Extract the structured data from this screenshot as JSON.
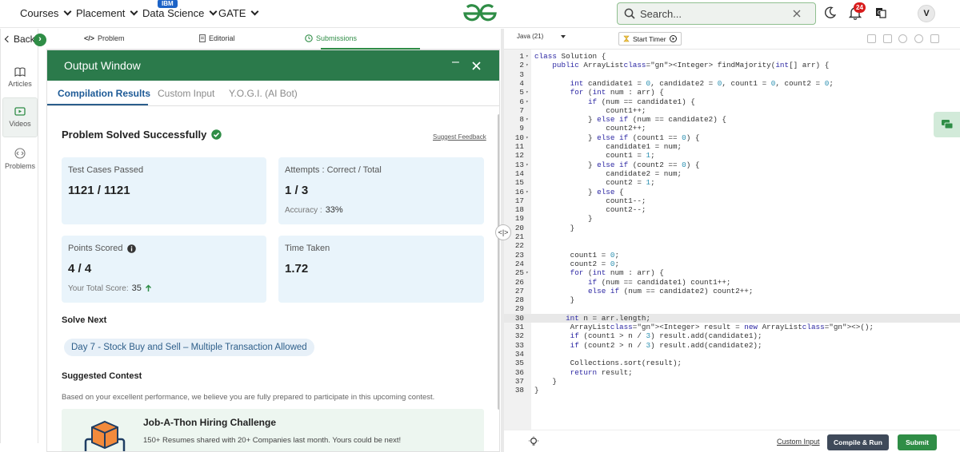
{
  "nav": {
    "items": [
      "Courses",
      "Placement",
      "Data Science",
      "GATE"
    ],
    "ibm_badge": "IBM",
    "search_placeholder": "Search...",
    "notification_count": "24",
    "avatar_initial": "V"
  },
  "rail": {
    "back_label": "Back",
    "items": [
      "Articles",
      "Videos",
      "Problems"
    ]
  },
  "problem_tabs": [
    "Problem",
    "Editorial",
    "Submissions"
  ],
  "output": {
    "title": "Output Window",
    "tabs": [
      "Compilation Results",
      "Custom Input",
      "Y.O.G.I. (AI Bot)"
    ],
    "status": "Problem Solved Successfully",
    "feedback_link": "Suggest Feedback",
    "cards": {
      "test_cases_label": "Test Cases Passed",
      "test_cases_value": "1121 / 1121",
      "attempts_label": "Attempts : Correct / Total",
      "attempts_value": "1 / 3",
      "accuracy_label": "Accuracy :",
      "accuracy_value": "33%",
      "points_label": "Points Scored",
      "points_value": "4 / 4",
      "total_score_label": "Your Total Score:",
      "total_score_value": "35",
      "time_label": "Time Taken",
      "time_value": "1.72"
    },
    "solve_next_heading": "Solve Next",
    "solve_next_item": "Day 7 - Stock Buy and Sell – Multiple Transaction Allowed",
    "contest_heading": "Suggested Contest",
    "contest_desc": "Based on your excellent performance, we believe you are fully prepared to participate in this upcoming contest.",
    "contest_title": "Job-A-Thon Hiring Challenge",
    "contest_text": "150+ Resumes shared with 20+ Companies last month. Yours could be next!"
  },
  "editor": {
    "language": "Java (21)",
    "timer_label": "Start Timer",
    "highlight_line": 30,
    "code_lines": [
      "class Solution {",
      "    public ArrayList<Integer> findMajority(int[] arr) {",
      "",
      "        int candidate1 = 0, candidate2 = 0, count1 = 0, count2 = 0;",
      "        for (int num : arr) {",
      "            if (num == candidate1) {",
      "                count1++;",
      "            } else if (num == candidate2) {",
      "                count2++;",
      "            } else if (count1 == 0) {",
      "                candidate1 = num;",
      "                count1 = 1;",
      "            } else if (count2 == 0) {",
      "                candidate2 = num;",
      "                count2 = 1;",
      "            } else {",
      "                count1--;",
      "                count2--;",
      "            }",
      "        }",
      "",
      "",
      "        count1 = 0;",
      "        count2 = 0;",
      "        for (int num : arr) {",
      "            if (num == candidate1) count1++;",
      "            else if (num == candidate2) count2++;",
      "        }",
      "",
      "       int n = arr.length;",
      "        ArrayList<Integer> result = new ArrayList<>();",
      "        if (count1 > n / 3) result.add(candidate1);",
      "        if (count2 > n / 3) result.add(candidate2);",
      "",
      "        Collections.sort(result);",
      "        return result;",
      "    }",
      "}"
    ],
    "folds": [
      1,
      2,
      5,
      6,
      8,
      10,
      13,
      16,
      25
    ],
    "custom_input_link": "Custom Input",
    "compile_label": "Compile & Run",
    "submit_label": "Submit"
  },
  "colors": {
    "brand_green": "#2f8d46",
    "header_green": "#2b7a4b",
    "card_blue": "#e9f4fb"
  }
}
